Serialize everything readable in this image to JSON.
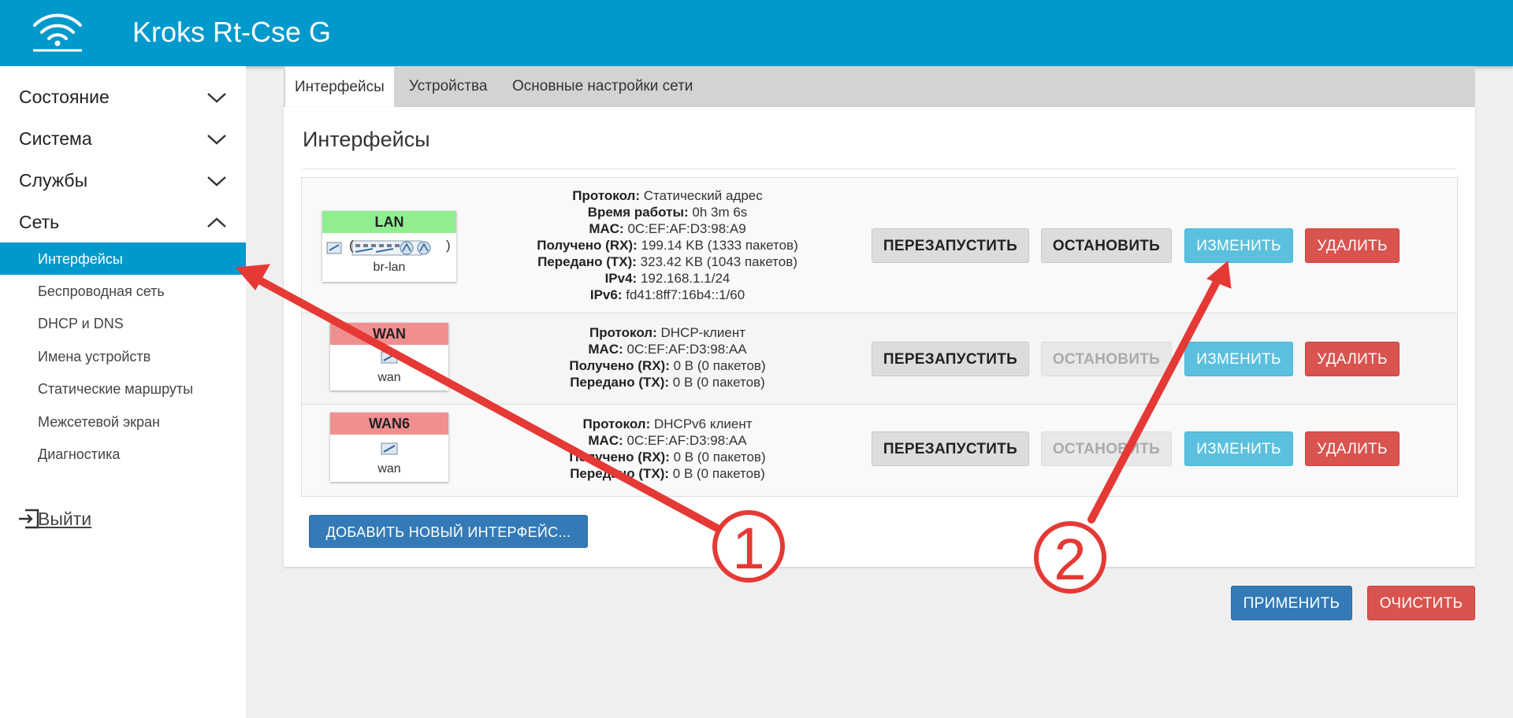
{
  "header": {
    "brand": "Kroks Rt-Cse G",
    "logo_icon": "wifi-logo-icon"
  },
  "sidebar": {
    "menus": [
      {
        "label": "Состояние",
        "expanded": false
      },
      {
        "label": "Система",
        "expanded": false
      },
      {
        "label": "Службы",
        "expanded": false
      },
      {
        "label": "Сеть",
        "expanded": true
      }
    ],
    "submenu": [
      {
        "label": "Интерфейсы",
        "active": true
      },
      {
        "label": "Беспроводная сеть"
      },
      {
        "label": "DHCP и DNS"
      },
      {
        "label": "Имена устройств"
      },
      {
        "label": "Статические маршруты"
      },
      {
        "label": "Межсетевой экран"
      },
      {
        "label": "Диагностика"
      }
    ],
    "logout": "Выйти"
  },
  "tabs": [
    "Интерфейсы",
    "Устройства",
    "Основные настройки сети"
  ],
  "panel": {
    "title": "Интерфейсы"
  },
  "interfaces": [
    {
      "name": "LAN",
      "color": "#90ee90",
      "device": "br-lan",
      "devices_paren_open": "(",
      "devices_paren_close": ")",
      "lines": [
        {
          "k": "Протокол:",
          "v": "Статический адрес"
        },
        {
          "k": "Время работы:",
          "v": "0h 3m 6s"
        },
        {
          "k": "MAC:",
          "v": "0C:EF:AF:D3:98:A9"
        },
        {
          "k": "Получено (RX):",
          "v": "199.14 KB (1333 пакетов)"
        },
        {
          "k": "Передано (TX):",
          "v": "323.42 KB (1043 пакетов)"
        },
        {
          "k": "IPv4:",
          "v": "192.168.1.1/24"
        },
        {
          "k": "IPv6:",
          "v": "fd41:8ff7:16b4::1/60"
        }
      ],
      "stop_enabled": true
    },
    {
      "name": "WAN",
      "color": "#f08f8f",
      "device": "wan",
      "lines": [
        {
          "k": "Протокол:",
          "v": "DHCP-клиент"
        },
        {
          "k": "MAC:",
          "v": "0C:EF:AF:D3:98:AA"
        },
        {
          "k": "Получено (RX):",
          "v": "0 B (0 пакетов)"
        },
        {
          "k": "Передано (TX):",
          "v": "0 B (0 пакетов)"
        }
      ],
      "stop_enabled": false
    },
    {
      "name": "WAN6",
      "color": "#f08f8f",
      "device": "wan",
      "lines": [
        {
          "k": "Протокол:",
          "v": "DHCPv6 клиент"
        },
        {
          "k": "MAC:",
          "v": "0C:EF:AF:D3:98:AA"
        },
        {
          "k": "Получено (RX):",
          "v": "0 B (0 пакетов)"
        },
        {
          "k": "Передано (TX):",
          "v": "0 B (0 пакетов)"
        }
      ],
      "stop_enabled": false
    }
  ],
  "row_buttons": {
    "restart": "ПЕРЕЗАПУСТИТЬ",
    "stop": "ОСТАНОВИТЬ",
    "edit": "ИЗМЕНИТЬ",
    "delete": "УДАЛИТЬ"
  },
  "add_button": "ДОБАВИТЬ НОВЫЙ ИНТЕРФЕЙС...",
  "footer": {
    "apply": "ПРИМЕНИТЬ",
    "reset": "ОЧИСТИТЬ"
  },
  "annotations": {
    "marker1": "1",
    "marker2": "2",
    "arrow_color": "#e53935"
  }
}
